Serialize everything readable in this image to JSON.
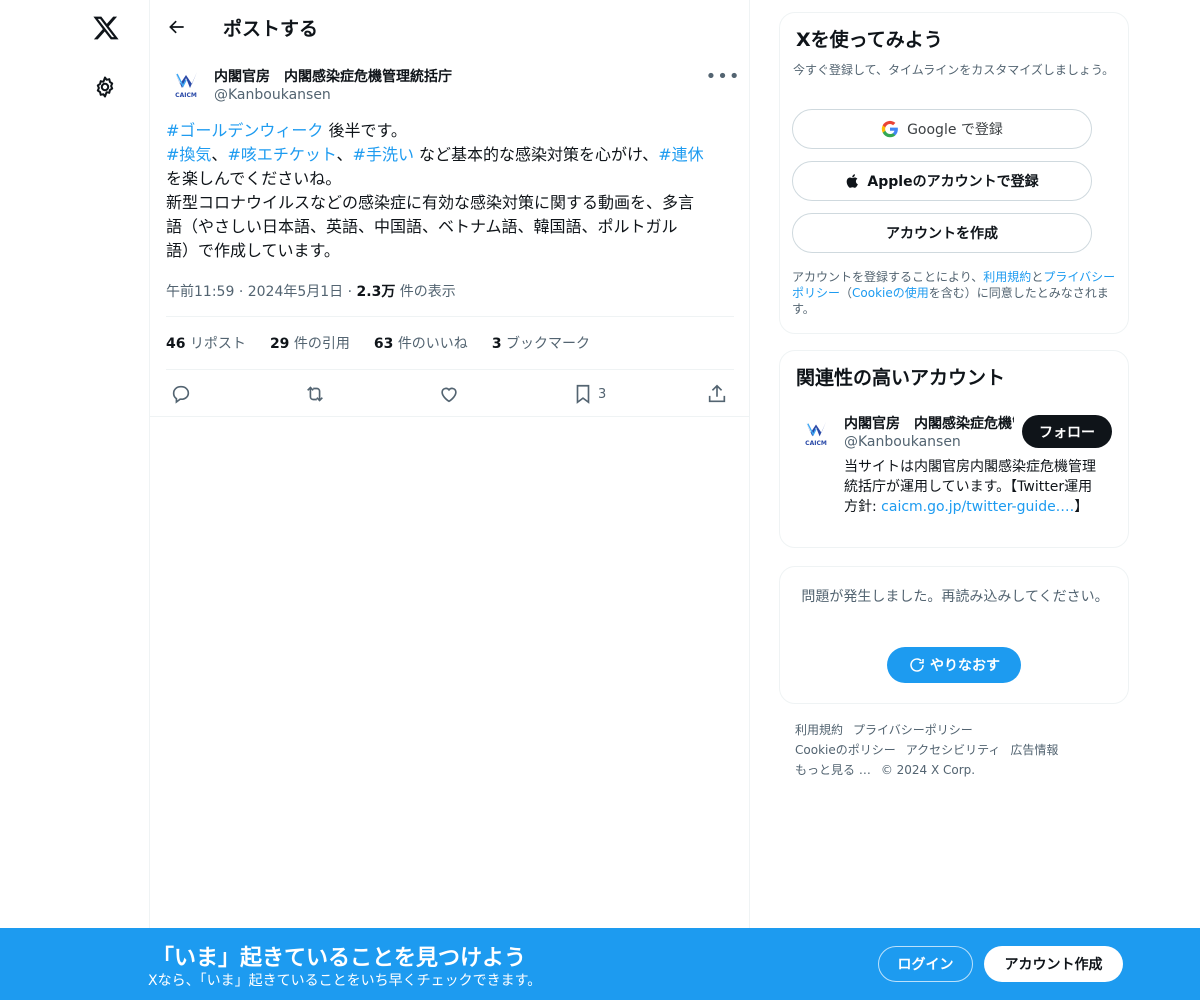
{
  "header": {
    "title": "ポストする"
  },
  "post": {
    "author_name": "内閣官房　内閣感染症危機管理統括庁",
    "author_handle": "@Kanboukansen",
    "avatar_text": "CAICM",
    "text": {
      "l1_tag": "#ゴールデンウィーク",
      "l1_rest": " 後半です。",
      "l2_tag1": "#換気",
      "l2_sep1": "、",
      "l2_tag2": "#咳エチケット",
      "l2_sep2": "、",
      "l2_tag3": "#手洗い",
      "l2_rest": " など基本的な感染対策を心がけ、",
      "l2_tag4": "#連休",
      "l3": "を楽しんでくださいね。",
      "l4": "新型コロナウイルスなどの感染症に有効な感染対策に関する動画を、多言",
      "l5": "語（やさしい日本語、英語、中国語、ベトナム語、韓国語、ポルトガル",
      "l6": "語）で作成しています。"
    },
    "time": "午前11:59",
    "date": "2024年5月1日",
    "views_count": "2.3万",
    "views_label": "件の表示",
    "dot": "·",
    "stats": {
      "reposts_count": "46",
      "reposts_label": "リポスト",
      "quotes_count": "29",
      "quotes_label": "件の引用",
      "likes_count": "63",
      "likes_label": "件のいいね",
      "bookmarks_count": "3",
      "bookmarks_label": "ブックマーク"
    },
    "bookmark_action_count": "3"
  },
  "signup": {
    "title": "Xを使ってみよう",
    "subtitle": "今すぐ登録して、タイムラインをカスタマイズしましょう。",
    "google_label": "Google で登録",
    "apple_label": "Appleのアカウントで登録",
    "create_label": "アカウントを作成",
    "legal": {
      "p1": "アカウントを登録することにより、",
      "terms": "利用規約",
      "p2": "と",
      "privacy": "プライバシーポリシー",
      "p3": "（",
      "cookie": "Cookieの使用",
      "p4": "を含む）に同意したとみなされます。"
    }
  },
  "related": {
    "title": "関連性の高いアカウント",
    "name": "内閣官房　内閣感染症危機管理統括庁",
    "handle": "@Kanboukansen",
    "avatar_text": "CAICM",
    "follow_label": "フォロー",
    "bio_text": "当サイトは内閣官房内閣感染症危機管理統括庁が運用しています。【Twitter運用方針: ",
    "bio_link": "caicm.go.jp/twitter-guide.…",
    "bio_end": "】"
  },
  "error_card": {
    "message": "問題が発生しました。再読み込みしてください。",
    "retry_label": "やりなおす"
  },
  "footer": {
    "terms": "利用規約",
    "privacy": "プライバシーポリシー",
    "cookie": "Cookieのポリシー",
    "accessibility": "アクセシビリティ",
    "ads": "広告情報",
    "more": "もっと見る …",
    "copyright": "© 2024 X Corp."
  },
  "banner": {
    "title": "「いま」起きていることを見つけよう",
    "subtitle": "Xなら、「いま」起きていることをいち早くチェックできます。",
    "login_label": "ログイン",
    "create_label": "アカウント作成"
  },
  "colors": {
    "accent": "#1d9bf0",
    "text": "#0f1419",
    "muted": "#536471",
    "border": "#eff3f4",
    "logo_blue": "#2a4aa8"
  },
  "icons": [
    "x-logo-icon",
    "gear-icon",
    "back-arrow-icon",
    "more-icon",
    "reply-icon",
    "repost-icon",
    "like-icon",
    "bookmark-icon",
    "share-icon",
    "google-icon",
    "apple-icon",
    "refresh-icon"
  ]
}
